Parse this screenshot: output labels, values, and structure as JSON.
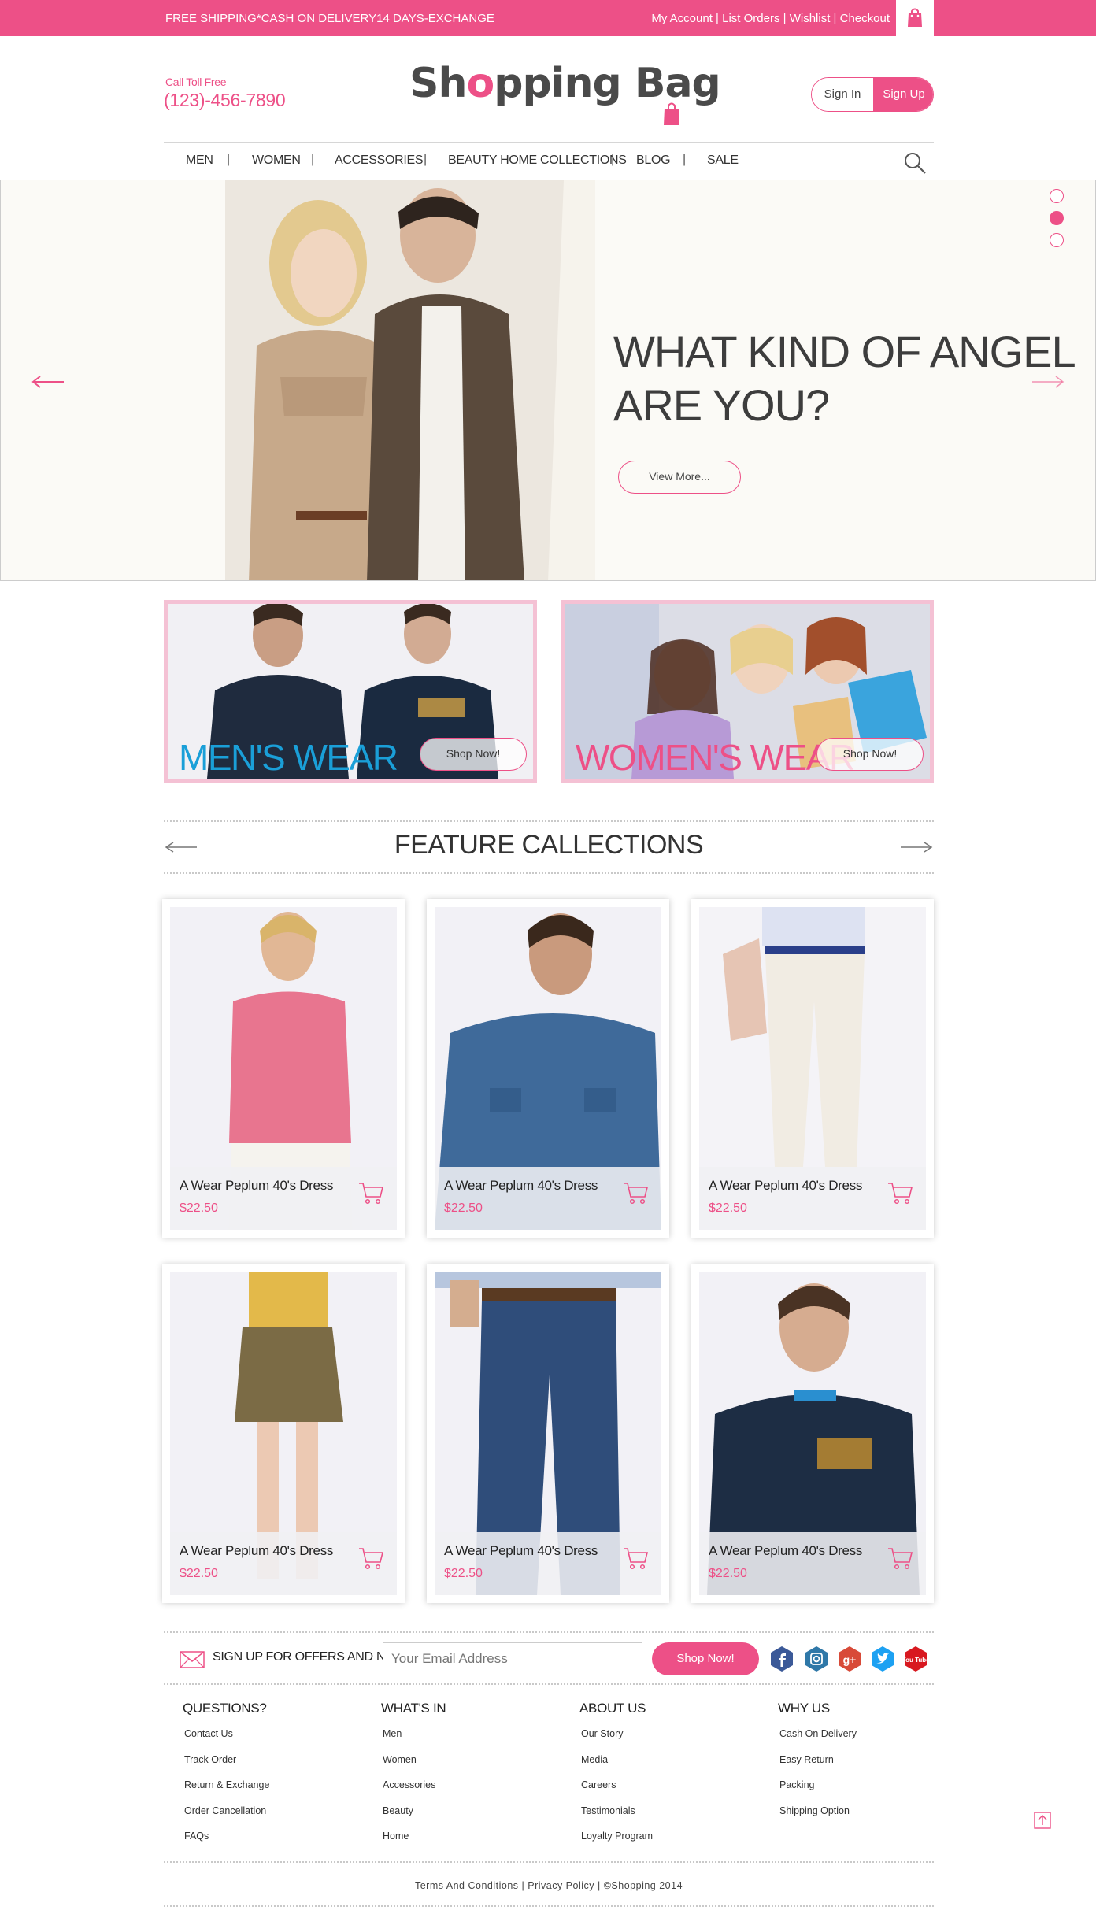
{
  "topbar": {
    "promo": "FREE SHIPPING*CASH ON DELIVERY14 DAYS-EXCHANGE",
    "links": [
      "My Account",
      "List Orders",
      "Wishlist",
      "Checkout"
    ],
    "separator": " | ",
    "bag_icon": "shopping-bag-icon"
  },
  "header": {
    "call_label": "Call Toll Free",
    "phone": "(123)-456-7890",
    "logo_part1": "Sh",
    "logo_o": "o",
    "logo_part2": "pping Bag",
    "signin": "Sign In",
    "signup": "Sign Up"
  },
  "nav": {
    "items": [
      "MEN",
      "WOMEN",
      "ACCESSORIES",
      "BEAUTY HOME COLLECTIONS",
      "BLOG",
      "SALE"
    ],
    "search_icon": "search-icon"
  },
  "hero": {
    "headline_line1": "WHAT KIND OF ANGEL",
    "headline_line2": "ARE YOU?",
    "cta": "View More...",
    "slides": 3,
    "active_slide": 2
  },
  "banners": [
    {
      "label": "MEN'S WEAR",
      "cta": "Shop Now!",
      "label_color": "#1a9fd8"
    },
    {
      "label": "WOMEN'S WEAR",
      "cta": "Shop Now!",
      "label_color": "#ed5087"
    }
  ],
  "features": {
    "title": "FEATURE CALLECTIONS",
    "products": [
      {
        "name": "A Wear Peplum 40's Dress",
        "price": "$22.50"
      },
      {
        "name": "A Wear Peplum 40's Dress",
        "price": "$22.50"
      },
      {
        "name": "A Wear Peplum 40's Dress",
        "price": "$22.50"
      },
      {
        "name": "A Wear Peplum 40's Dress",
        "price": "$22.50"
      },
      {
        "name": "A Wear Peplum 40's Dress",
        "price": "$22.50"
      },
      {
        "name": "A Wear Peplum 40's Dress",
        "price": "$22.50"
      }
    ]
  },
  "newsletter": {
    "label": "SIGN UP FOR OFFERS AND NEWS",
    "placeholder": "Your Email Address",
    "button": "Shop Now!",
    "social": [
      "facebook-icon",
      "instagram-icon",
      "google-plus-icon",
      "twitter-icon",
      "youtube-icon"
    ],
    "g_plus": "g+",
    "yt": "You Tube"
  },
  "footer": {
    "columns": [
      {
        "title": "QUESTIONS?",
        "links": [
          "Contact Us",
          "Track Order",
          "Return & Exchange",
          "Order Cancellation",
          "FAQs"
        ]
      },
      {
        "title": "WHAT'S IN",
        "links": [
          "Men",
          "Women",
          "Accessories",
          "Beauty",
          "Home"
        ]
      },
      {
        "title": "ABOUT US",
        "links": [
          "Our Story",
          "Media",
          "Careers",
          "Testimonials",
          "Loyalty Program"
        ]
      },
      {
        "title": "WHY US",
        "links": [
          "Cash On Delivery",
          "Easy Return",
          "Packing",
          "Shipping Option"
        ]
      }
    ],
    "bottom": "Terms And Conditions | Privacy Policy | ©Shopping 2014"
  },
  "colors": {
    "accent": "#ed5087",
    "men": "#1a9fd8",
    "border_pink": "#f4c1d4"
  }
}
